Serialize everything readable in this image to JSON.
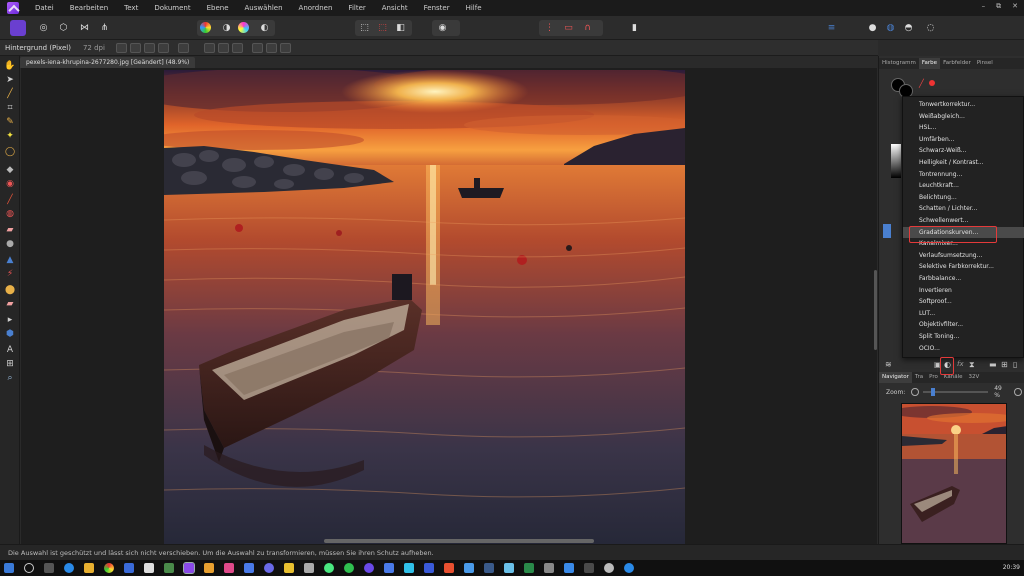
{
  "menu": {
    "items": [
      "Datei",
      "Bearbeiten",
      "Text",
      "Dokument",
      "Ebene",
      "Auswählen",
      "Anordnen",
      "Filter",
      "Ansicht",
      "Fenster",
      "Hilfe"
    ]
  },
  "window_controls": {
    "minimize": "–",
    "restore": "⧉",
    "close": "✕"
  },
  "context": {
    "layer_name": "Hintergrund (Pixel)",
    "dpi": "72 dpi"
  },
  "document": {
    "tab_title": "pexels-iena-khrupina-2677280.jpg [Geändert] (48.9%)"
  },
  "panels": {
    "top_tabs": [
      "Histogramm",
      "Farbe",
      "Farbfelder",
      "Pinsel"
    ],
    "top_active": "Farbe",
    "bottom_tabs": [
      "Navigator",
      "Tra",
      "Pro",
      "Kanäle",
      "32V"
    ],
    "bottom_active": "Navigator"
  },
  "adjustment_menu": {
    "items": [
      "Tonwertkorrektur...",
      "Weißabgleich...",
      "HSL...",
      "Umfärben...",
      "Schwarz-Weiß...",
      "Helligkeit / Kontrast...",
      "Tontrennung...",
      "Leuchtkraft...",
      "Belichtung...",
      "Schatten / Lichter...",
      "Schwellenwert...",
      "Gradationskurven...",
      "Kanalmixer...",
      "Verlaufsumsetzung...",
      "Selektive Farbkorrektur...",
      "Farbbalance...",
      "Invertieren",
      "Softproof...",
      "LUT...",
      "Objektivfilter...",
      "Split Toning...",
      "OCIO..."
    ],
    "highlighted": "Gradationskurven..."
  },
  "navigator": {
    "zoom_label": "Zoom:",
    "zoom_value": "49 %"
  },
  "status": {
    "message": "Die Auswahl ist geschützt und lässt sich nicht verschieben. Um die Auswahl zu transformieren, müssen Sie ihren Schutz aufheben."
  },
  "taskbar": {
    "clock": "20:39"
  },
  "colors": {
    "accent": "#8a3ff0",
    "highlight_box": "#e43a3a",
    "selection_blue": "#4a80d0"
  }
}
